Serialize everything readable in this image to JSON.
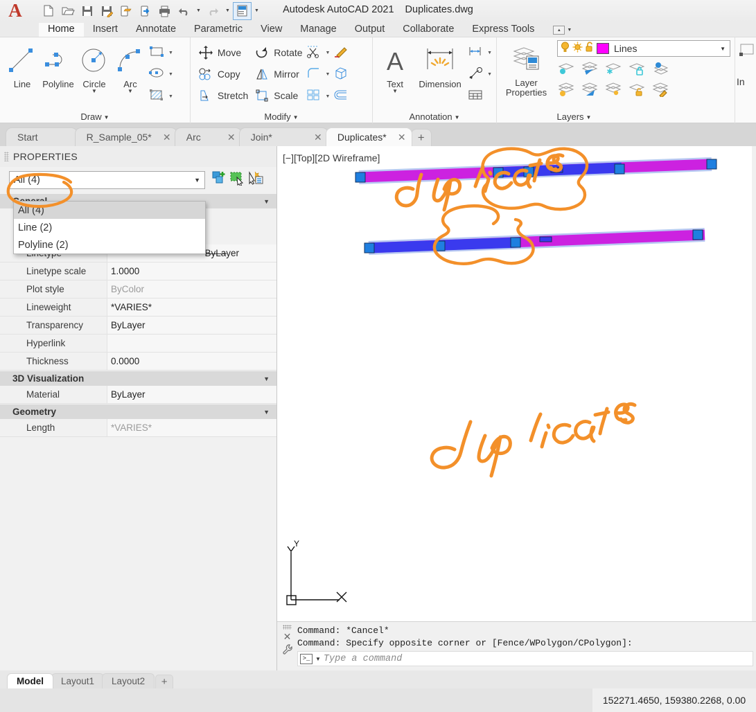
{
  "app": {
    "title": "Autodesk AutoCAD 2021",
    "filename": "Duplicates.dwg",
    "logo": "autocad-a-logo"
  },
  "quick_access": {
    "items": [
      {
        "name": "new-icon",
        "label": "New"
      },
      {
        "name": "open-icon",
        "label": "Open"
      },
      {
        "name": "save-icon",
        "label": "Save"
      },
      {
        "name": "save-as-icon",
        "label": "Save As"
      },
      {
        "name": "save-to-web-icon",
        "label": "Save to Web & Mobile"
      },
      {
        "name": "open-from-web-icon",
        "label": "Open from Web & Mobile"
      },
      {
        "name": "plot-icon",
        "label": "Plot"
      },
      {
        "name": "undo-icon",
        "label": "Undo"
      },
      {
        "name": "redo-icon",
        "label": "Redo"
      },
      {
        "name": "workspace-icon",
        "label": "Workspace Switching"
      }
    ]
  },
  "ribbon": {
    "tabs": [
      {
        "label": "Home",
        "active": true
      },
      {
        "label": "Insert",
        "active": false
      },
      {
        "label": "Annotate",
        "active": false
      },
      {
        "label": "Parametric",
        "active": false
      },
      {
        "label": "View",
        "active": false
      },
      {
        "label": "Manage",
        "active": false
      },
      {
        "label": "Output",
        "active": false
      },
      {
        "label": "Collaborate",
        "active": false
      },
      {
        "label": "Express Tools",
        "active": false
      }
    ],
    "panels": {
      "draw": {
        "title": "Draw",
        "big_buttons": [
          {
            "label": "Line",
            "icon": "line-icon",
            "has_caret": false
          },
          {
            "label": "Polyline",
            "icon": "polyline-icon",
            "has_caret": false
          },
          {
            "label": "Circle",
            "icon": "circle-icon",
            "has_caret": true
          },
          {
            "label": "Arc",
            "icon": "arc-icon",
            "has_caret": true
          }
        ],
        "small_icons": [
          {
            "icon": "rectangle-icon",
            "label": "Rectangle"
          },
          {
            "icon": "ellipse-icon",
            "label": "Ellipse"
          },
          {
            "icon": "hatch-icon",
            "label": "Hatch"
          }
        ]
      },
      "modify": {
        "title": "Modify",
        "buttons": [
          {
            "label": "Move",
            "icon": "move-icon"
          },
          {
            "label": "Rotate",
            "icon": "rotate-icon"
          },
          {
            "label": "Copy",
            "icon": "copy-icon"
          },
          {
            "label": "Mirror",
            "icon": "mirror-icon"
          },
          {
            "label": "Stretch",
            "icon": "stretch-icon"
          },
          {
            "label": "Scale",
            "icon": "scale-icon"
          }
        ],
        "small_icons": [
          {
            "icon": "trim-icon",
            "label": "Trim"
          },
          {
            "icon": "fillet-icon",
            "label": "Fillet"
          },
          {
            "icon": "array-icon",
            "label": "Array"
          },
          {
            "icon": "erase-icon",
            "label": "Erase"
          },
          {
            "icon": "extrude-icon",
            "label": "Extrude"
          },
          {
            "icon": "offset-icon",
            "label": "Offset"
          }
        ]
      },
      "annotation": {
        "title": "Annotation",
        "big_buttons": [
          {
            "label": "Text",
            "icon": "text-icon",
            "has_caret": true
          },
          {
            "label": "Dimension",
            "icon": "dimension-icon",
            "has_caret": false
          }
        ],
        "small_icons": [
          {
            "icon": "dimension-style-icon",
            "label": "Dimension Style"
          },
          {
            "icon": "leader-icon",
            "label": "Leader"
          },
          {
            "icon": "table-icon",
            "label": "Table"
          }
        ]
      },
      "layers": {
        "title": "Layers",
        "layer_properties_label": "Layer\nProperties",
        "layer_properties_line1": "Layer",
        "layer_properties_line2": "Properties",
        "current_layer": "Lines",
        "layer_color": "#ff00ff",
        "states": {
          "on_icon": "lightbulb-on-icon",
          "thaw_icon": "sun-icon",
          "unlock_icon": "unlock-icon"
        },
        "tool_icons": [
          "layer-off-icon",
          "layer-isolate-icon",
          "layer-freeze-icon",
          "layer-lock-icon",
          "layer-make-current-icon",
          "layer-turn-all-on-icon",
          "layer-unisolate-icon",
          "layer-thaw-all-icon",
          "layer-unlock-icon",
          "layer-match-icon"
        ]
      },
      "insert_partial": {
        "label": "In"
      }
    }
  },
  "file_tabs": [
    {
      "label": "Start",
      "closable": false,
      "active": false
    },
    {
      "label": "R_Sample_05*",
      "closable": true,
      "active": false
    },
    {
      "label": "Arc",
      "closable": true,
      "active": false
    },
    {
      "label": "Join*",
      "closable": true,
      "active": false
    },
    {
      "label": "Duplicates*",
      "closable": true,
      "active": true
    }
  ],
  "file_tabs_add_label": "+",
  "properties": {
    "header": "PROPERTIES",
    "selector_value": "All (4)",
    "dropdown_open": true,
    "dropdown_options": [
      {
        "label": "All (4)",
        "selected": true
      },
      {
        "label": "Line (2)",
        "selected": false
      },
      {
        "label": "Polyline (2)",
        "selected": false
      }
    ],
    "tool_icons": [
      "quick-select-icon",
      "select-objects-icon",
      "quick-properties-icon"
    ],
    "sections": [
      {
        "title": "General",
        "hidden_behind_dropdown": true,
        "rows": [
          {
            "key": "Linetype",
            "value": "ByLayer",
            "style": "linetype"
          },
          {
            "key": "Linetype scale",
            "value": "1.0000",
            "style": "normal"
          },
          {
            "key": "Plot style",
            "value": "ByColor",
            "style": "dim"
          },
          {
            "key": "Lineweight",
            "value": "*VARIES*",
            "style": "normal"
          },
          {
            "key": "Transparency",
            "value": "ByLayer",
            "style": "normal"
          },
          {
            "key": "Hyperlink",
            "value": "",
            "style": "normal"
          },
          {
            "key": "Thickness",
            "value": "0.0000",
            "style": "normal"
          }
        ]
      },
      {
        "title": "3D Visualization",
        "rows": [
          {
            "key": "Material",
            "value": "ByLayer",
            "style": "normal"
          }
        ]
      },
      {
        "title": "Geometry",
        "rows": [
          {
            "key": "Length",
            "value": "*VARIES*",
            "style": "dim"
          }
        ]
      }
    ]
  },
  "viewport": {
    "controls": "[−][Top][2D Wireframe]",
    "ucs": {
      "x_label": "X",
      "y_label": "Y"
    },
    "annotations": [
      {
        "type": "handwriting",
        "text": "duplicates",
        "color": "#f3902a",
        "position": "top"
      },
      {
        "type": "handwriting",
        "text": "duplicates",
        "color": "#f3902a",
        "position": "bottom"
      },
      {
        "type": "circle-markup",
        "color": "#f3902a",
        "target": "upper-line-overlap"
      },
      {
        "type": "circle-markup",
        "color": "#f3902a",
        "target": "lower-line-overlap"
      },
      {
        "type": "circle-markup",
        "color": "#f3902a",
        "target": "properties-selector"
      }
    ],
    "entities": [
      {
        "name": "polyline-upper",
        "color": "#cc22e0",
        "selected": true,
        "grips": 6
      },
      {
        "name": "line-upper-overlap",
        "color": "#3a3aee",
        "selected": true
      },
      {
        "name": "polyline-lower",
        "color": "#cc22e0",
        "selected": true,
        "grips": 5
      },
      {
        "name": "line-lower-overlap",
        "color": "#3a3aee",
        "selected": true
      }
    ],
    "grip_color": "#1f7fe0"
  },
  "command_line": {
    "history": [
      "Command: *Cancel*",
      "Command: Specify opposite corner or [Fence/WPolygon/CPolygon]:"
    ],
    "placeholder": "Type a command",
    "close_icon": "close-icon",
    "customize_icon": "wrench-icon",
    "prompt_icon": "command-prompt-icon"
  },
  "layout_tabs": [
    {
      "label": "Model",
      "active": true
    },
    {
      "label": "Layout1",
      "active": false
    },
    {
      "label": "Layout2",
      "active": false
    }
  ],
  "layout_tabs_add_label": "+",
  "status_bar": {
    "coordinates": "152271.4650, 159380.2268, 0.00"
  }
}
